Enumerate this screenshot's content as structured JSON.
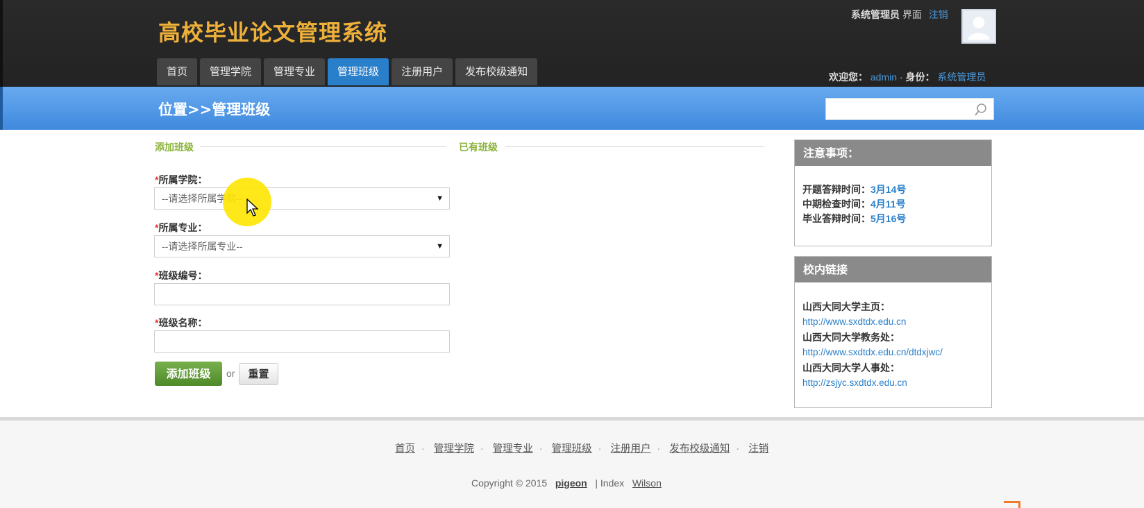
{
  "header": {
    "site_title": "高校毕业论文管理系统",
    "nav": [
      {
        "label": "首页"
      },
      {
        "label": "管理学院"
      },
      {
        "label": "管理专业"
      },
      {
        "label": "管理班级",
        "active": true
      },
      {
        "label": "注册用户"
      },
      {
        "label": "发布校级通知"
      }
    ],
    "role_label": "系统管理员",
    "interface_label": "界面",
    "logout_label": "注销",
    "welcome_prefix": "欢迎您：",
    "username": "admin",
    "identity_label": "身份：",
    "identity_value": "系统管理员"
  },
  "bluebar": {
    "location": "位置>>管理班级",
    "search_placeholder": ""
  },
  "form": {
    "add_section_title": "添加班级",
    "existing_section_title": "已有班级",
    "college_label": "所属学院：",
    "college_select": "--请选择所属学院--",
    "major_label": "所属专业：",
    "major_select": "--请选择所属专业--",
    "class_no_label": "班级编号：",
    "class_no_value": "",
    "class_name_label": "班级名称：",
    "class_name_value": "",
    "required_mark": "*",
    "add_button": "添加班级",
    "or_text": "or",
    "reset_button": "重置"
  },
  "notice_panel": {
    "title": "注意事项：",
    "items": [
      {
        "key": "开题答辩时间：",
        "value": "3月14号"
      },
      {
        "key": "中期检查时间：",
        "value": "4月11号"
      },
      {
        "key": "毕业答辩时间：",
        "value": "5月16号"
      }
    ]
  },
  "links_panel": {
    "title": "校内链接",
    "items": [
      {
        "name": "山西大同大学主页：",
        "url": "http://www.sxdtdx.edu.cn"
      },
      {
        "name": "山西大同大学教务处：",
        "url": "http://www.sxdtdx.edu.cn/dtdxjwc/"
      },
      {
        "name": "山西大同大学人事处：",
        "url": "http://zsjyc.sxdtdx.edu.cn"
      }
    ]
  },
  "footer": {
    "links": [
      "首页",
      "管理学院",
      "管理专业",
      "管理班级",
      "注册用户",
      "发布校级通知",
      "注销"
    ],
    "copyright_prefix": "Copyright © 2015",
    "author": "pigeon",
    "separator": "| Index",
    "designer": "Wilson"
  },
  "colors": {
    "title_gold": "#f0b13a",
    "active_tab": "#2a7fcb",
    "section_green": "#8bb33a",
    "link_blue": "#2a7fcb",
    "add_button_green": "#5e9a34"
  }
}
